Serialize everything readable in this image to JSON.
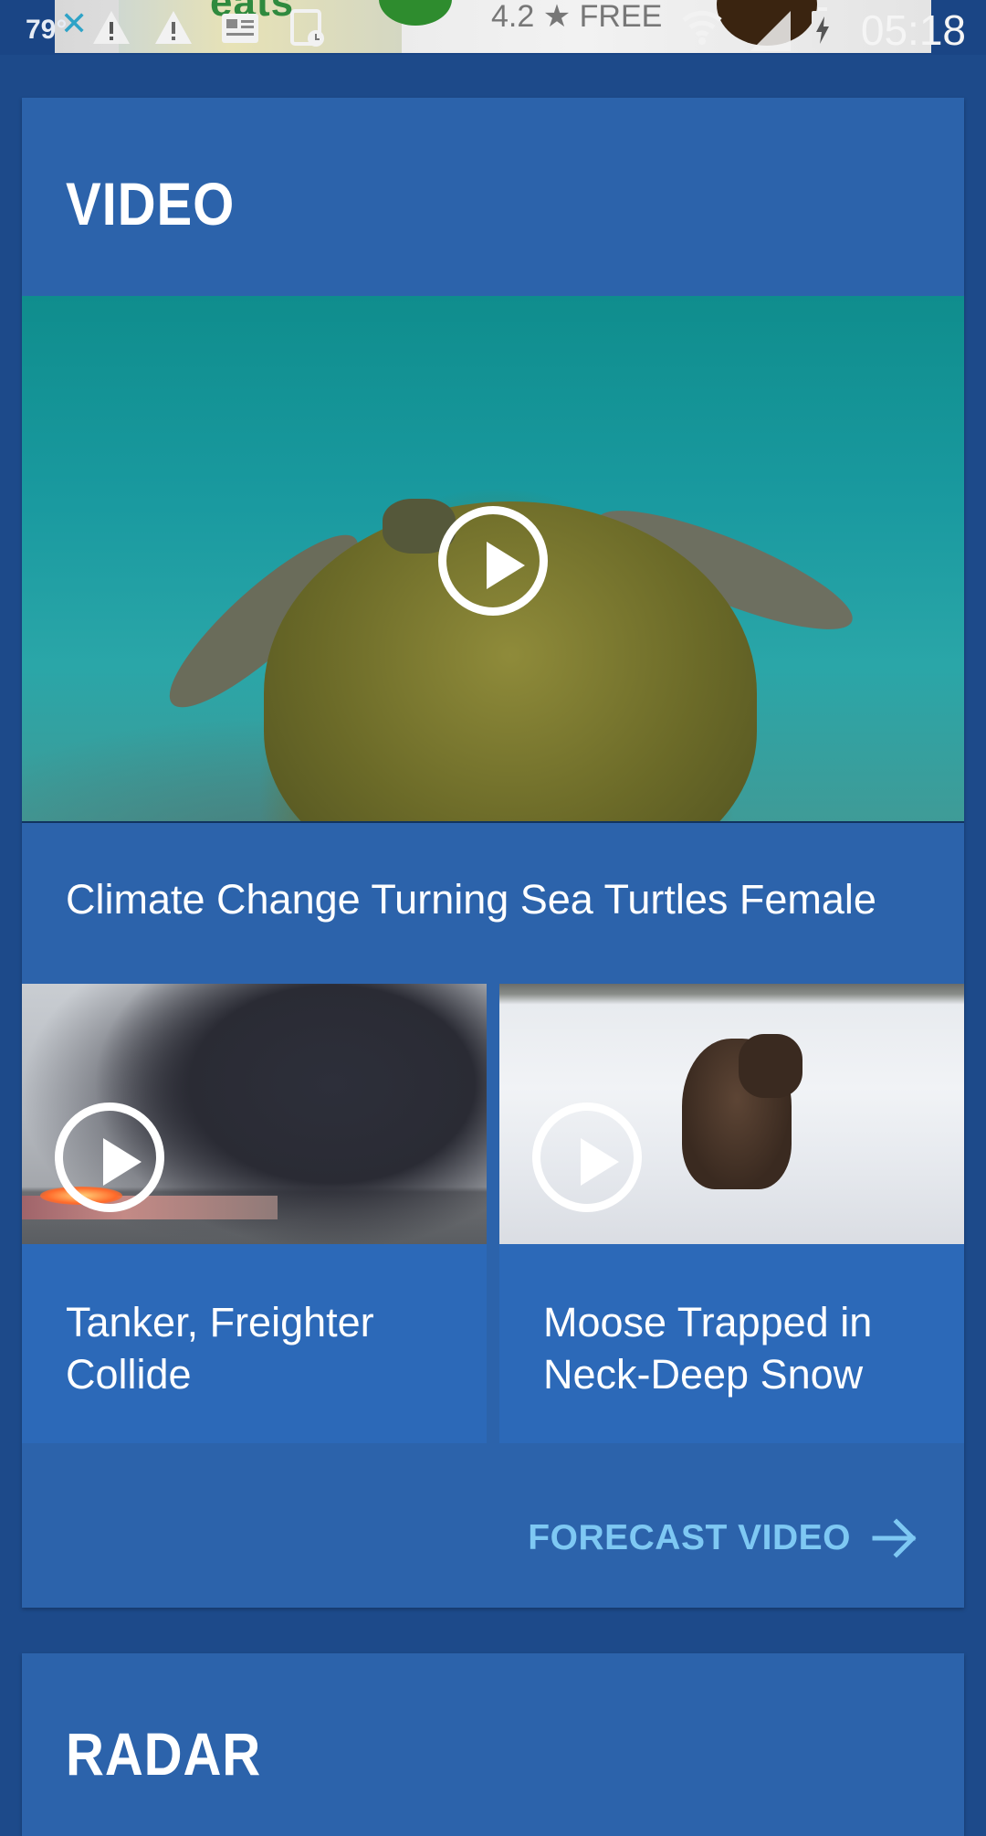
{
  "status_bar": {
    "temperature": "79°",
    "time": "05:18",
    "ad": {
      "brand_text": "eats",
      "rating_text": "4.2 ★ FREE"
    }
  },
  "video_card": {
    "title": "VIDEO",
    "hero": {
      "caption": "Climate Change Turning Sea Turtles Female"
    },
    "tiles": [
      {
        "caption": "Tanker, Freighter Collide"
      },
      {
        "caption": "Moose Trapped in Neck-Deep Snow"
      }
    ],
    "forecast_link": "FORECAST VIDEO"
  },
  "radar_card": {
    "title": "RADAR"
  },
  "colors": {
    "page_bg": "#1d4a8a",
    "card_bg": "#2c63ab",
    "link": "#7ec8f3"
  }
}
